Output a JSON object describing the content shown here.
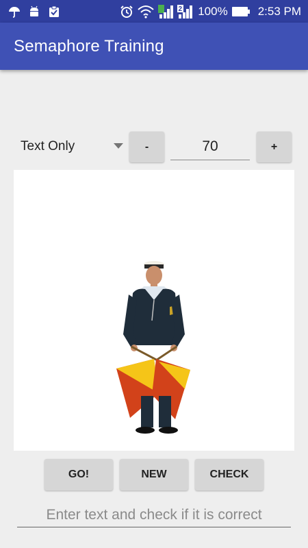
{
  "status_bar": {
    "battery_text": "100%",
    "time": "2:53 PM",
    "left_icons": [
      "umbrella-icon",
      "android-icon",
      "clipboard-check-icon"
    ],
    "right_icons": [
      "alarm-icon",
      "wifi-icon",
      "signal-icon",
      "sim2-signal-icon",
      "battery-icon"
    ],
    "sim_label": "2"
  },
  "app_bar": {
    "title": "Semaphore Training"
  },
  "controls": {
    "mode_selected": "Text Only",
    "minus_label": "-",
    "plus_label": "+",
    "speed_value": "70"
  },
  "image": {
    "icon": "semaphore-sailor-figure",
    "flag_colors": [
      "#f5c518",
      "#d2421a"
    ],
    "uniform_color": "#1f2d3a"
  },
  "actions": {
    "go_label": "GO!",
    "new_label": "NEW",
    "check_label": "CHECK"
  },
  "answer": {
    "value": "",
    "placeholder": "Enter text and check if it is correct"
  },
  "colors": {
    "status_bar": "#303f9f",
    "app_bar": "#3f51b5",
    "background": "#eeeeee",
    "button": "#d6d6d6"
  }
}
